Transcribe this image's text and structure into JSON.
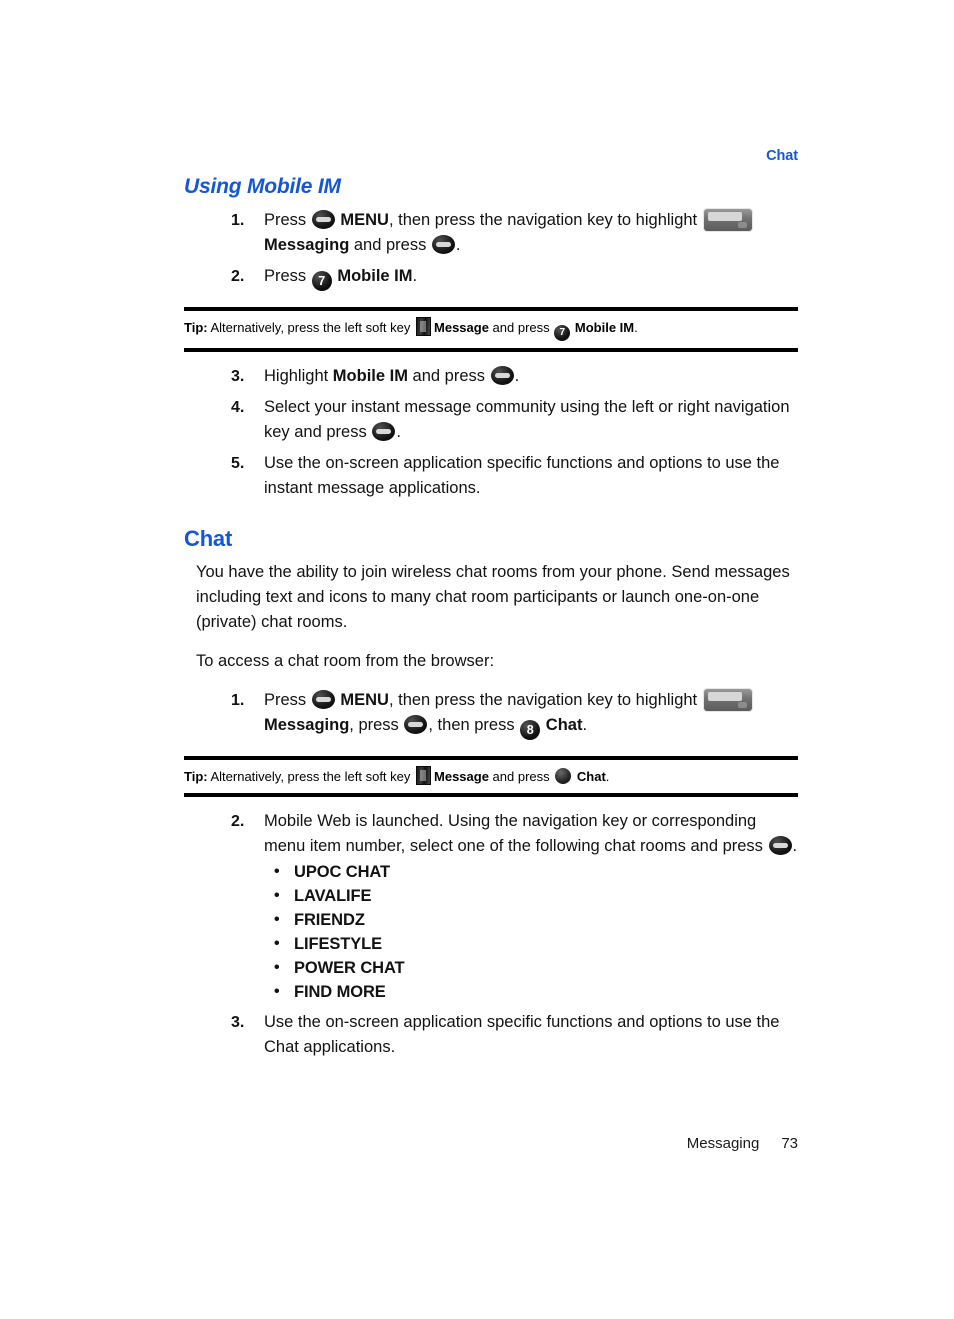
{
  "header": {
    "running_head": "Chat",
    "running_head_color": "#1457d6"
  },
  "sections": [
    {
      "id": "using-mobile-im",
      "title": "Using Mobile IM",
      "style": "italic"
    },
    {
      "id": "chat",
      "title": "Chat",
      "style": "upright"
    }
  ],
  "mobile_im": {
    "steps": [
      {
        "num": "1.",
        "parts": [
          {
            "t": "text",
            "v": "Press "
          },
          {
            "t": "icon",
            "v": "ok-key-icon"
          },
          {
            "t": "bold",
            "v": " MENU"
          },
          {
            "t": "text",
            "v": ", then press the navigation key to highlight "
          },
          {
            "t": "icon",
            "v": "messaging-envelope-icon"
          },
          {
            "t": "bold",
            "v": "Messaging"
          },
          {
            "t": "text",
            "v": " and press "
          },
          {
            "t": "icon",
            "v": "ok-key-icon"
          },
          {
            "t": "text",
            "v": "."
          }
        ]
      },
      {
        "num": "2.",
        "parts": [
          {
            "t": "text",
            "v": "Press "
          },
          {
            "t": "icon",
            "v": "key-7-icon"
          },
          {
            "t": "bold",
            "v": " Mobile IM"
          },
          {
            "t": "text",
            "v": "."
          }
        ]
      }
    ],
    "tip": {
      "label": "Tip:",
      "before_softkey": " Alternatively, press the left soft key ",
      "softkey_icon": "left-soft-key-icon",
      "softkey_label": "Message",
      "middle": " and press ",
      "key_icon": "key-7-icon",
      "key_digit": "7",
      "after_label": "Mobile IM",
      "period": "."
    },
    "steps_after_tip": [
      {
        "num": "3.",
        "parts": [
          {
            "t": "text",
            "v": "Highlight "
          },
          {
            "t": "bold",
            "v": "Mobile IM"
          },
          {
            "t": "text",
            "v": " and press "
          },
          {
            "t": "icon",
            "v": "ok-key-icon"
          },
          {
            "t": "text",
            "v": "."
          }
        ]
      },
      {
        "num": "4.",
        "parts": [
          {
            "t": "text",
            "v": "Select your instant message community using the left or right navigation key and press "
          },
          {
            "t": "icon",
            "v": "ok-key-icon"
          },
          {
            "t": "text",
            "v": "."
          }
        ]
      },
      {
        "num": "5.",
        "parts": [
          {
            "t": "text",
            "v": "Use the on-screen application specific functions and options to use the instant message applications."
          }
        ]
      }
    ]
  },
  "chat": {
    "intro_paragraph": "You have the ability to join wireless chat rooms from your phone. Send messages including text and icons to many chat room participants or launch one-on-one (private) chat rooms.",
    "access_paragraph": "To access a chat room from the browser:",
    "steps": [
      {
        "num": "1.",
        "parts": [
          {
            "t": "text",
            "v": "Press "
          },
          {
            "t": "icon",
            "v": "ok-key-icon"
          },
          {
            "t": "bold",
            "v": " MENU"
          },
          {
            "t": "text",
            "v": ", then press the navigation key to highlight "
          },
          {
            "t": "icon",
            "v": "messaging-envelope-icon"
          },
          {
            "t": "bold",
            "v": "Messaging"
          },
          {
            "t": "text",
            "v": ", press "
          },
          {
            "t": "icon",
            "v": "ok-key-icon"
          },
          {
            "t": "text",
            "v": ", then press "
          },
          {
            "t": "icon",
            "v": "key-8-icon"
          },
          {
            "t": "bold",
            "v": " Chat"
          },
          {
            "t": "text",
            "v": "."
          }
        ]
      }
    ],
    "tip": {
      "label": "Tip:",
      "before_softkey": " Alternatively, press the left soft key ",
      "softkey_icon": "left-soft-key-icon",
      "softkey_label": "Message",
      "middle": " and press ",
      "key_icon": "chat-round-key-icon",
      "after_label": "Chat",
      "period": "."
    },
    "steps_after_tip": [
      {
        "num": "2.",
        "parts": [
          {
            "t": "text",
            "v": "Mobile Web is launched. Using the navigation key or corresponding menu item number, select one of the following chat rooms and press "
          },
          {
            "t": "icon",
            "v": "ok-key-icon"
          },
          {
            "t": "text",
            "v": "."
          }
        ]
      }
    ],
    "chat_rooms": [
      "UPOC CHAT",
      "LAVALIFE",
      "FRIENDZ",
      "LIFESTYLE",
      "POWER CHAT",
      "FIND MORE"
    ],
    "bullet_glyph": "•",
    "final_step": {
      "num": "3.",
      "text": "Use the on-screen application specific functions and options to use the Chat applications."
    }
  },
  "key_digits": {
    "seven": "7",
    "eight": "8"
  },
  "footer": {
    "chapter": "Messaging",
    "page_number": "73"
  }
}
